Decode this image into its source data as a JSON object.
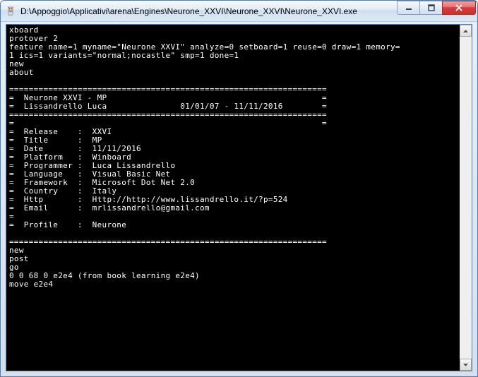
{
  "window": {
    "title": "D:\\Appoggio\\Applicativi\\arena\\Engines\\Neurone_XXVI\\Neurone_XXVI\\Neurone_XXVI.exe"
  },
  "console": {
    "lines": [
      "xboard",
      "protover 2",
      "feature name=1 myname=\"Neurone XXVI\" analyze=0 setboard=1 reuse=0 draw=1 memory=",
      "1 ics=1 variants=\"normal;nocastle\" smp=1 done=1",
      "new",
      "about",
      "",
      "=================================================================",
      "=  Neurone XXVI - MP                                            =",
      "=  Lissandrello Luca               01/01/07 - 11/11/2016        =",
      "=================================================================",
      "=                                                               =",
      "=  Release    :  XXVI",
      "=  Title      :  MP",
      "=  Date       :  11/11/2016",
      "=  Platform   :  Winboard",
      "=  Programmer :  Luca Lissandrello",
      "=  Language   :  Visual Basic Net",
      "=  Framework  :  Microsoft Dot Net 2.0",
      "=  Country    :  Italy",
      "=  Http       :  Http://http://www.lissandrello.it/?p=524",
      "=  Email      :  mrlissandrello@gmail.com",
      "=",
      "=  Profile    :  Neurone",
      "",
      "=================================================================",
      "new",
      "post",
      "go",
      "0 0 68 0 e2e4 (from book learning e2e4)",
      "move e2e4"
    ]
  }
}
